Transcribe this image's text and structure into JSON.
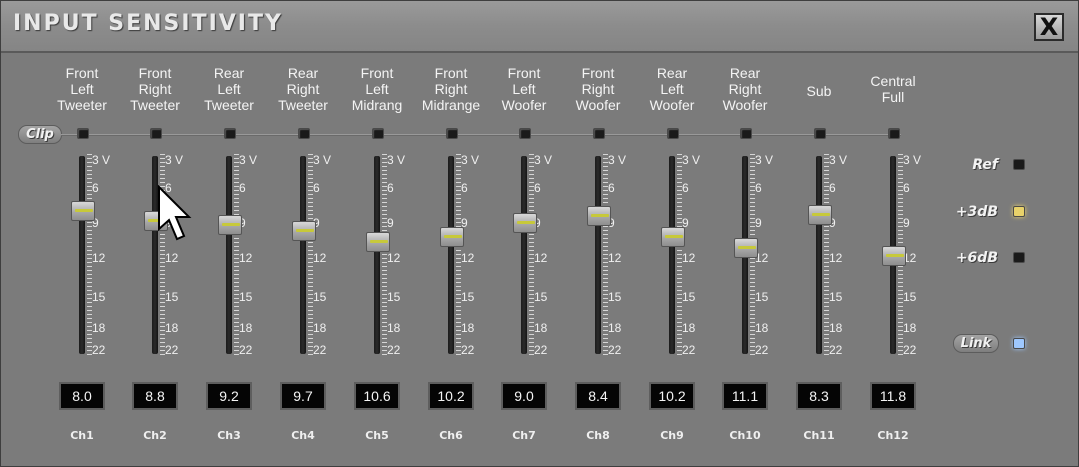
{
  "window": {
    "title": "INPUT SENSITIVITY",
    "close_label": "X"
  },
  "clip_label": "Clip",
  "scale_labels": [
    "3 V",
    "6",
    "9",
    "12",
    "15",
    "18",
    "22"
  ],
  "channels": [
    {
      "name": "Front\nLeft\nTweeter",
      "value": "8.0",
      "ch": "Ch1"
    },
    {
      "name": "Front\nRight\nTweeter",
      "value": "8.8",
      "ch": "Ch2"
    },
    {
      "name": "Rear\nLeft\nTweeter",
      "value": "9.2",
      "ch": "Ch3"
    },
    {
      "name": "Rear\nRight\nTweeter",
      "value": "9.7",
      "ch": "Ch4"
    },
    {
      "name": "Front\nLeft\nMidrang",
      "value": "10.6",
      "ch": "Ch5"
    },
    {
      "name": "Front\nRight\nMidrange",
      "value": "10.2",
      "ch": "Ch6"
    },
    {
      "name": "Front\nLeft\nWoofer",
      "value": "9.0",
      "ch": "Ch7"
    },
    {
      "name": "Front\nRight\nWoofer",
      "value": "8.4",
      "ch": "Ch8"
    },
    {
      "name": "Rear\nLeft\nWoofer",
      "value": "10.2",
      "ch": "Ch9"
    },
    {
      "name": "Rear\nRight\nWoofer",
      "value": "11.1",
      "ch": "Ch10"
    },
    {
      "name": "Sub",
      "value": "8.3",
      "ch": "Ch11"
    },
    {
      "name": "Central\nFull",
      "value": "11.8",
      "ch": "Ch12"
    }
  ],
  "side": {
    "ref_label": "Ref",
    "plus3_label": "+3dB",
    "plus6_label": "+6dB",
    "link_label": "Link",
    "plus3_active": true,
    "link_active": true
  },
  "colors": {
    "led_off": "#1a1a1a",
    "led_plus3_on": "#e8d26a",
    "led_link_on": "#9ec8ff",
    "knob_accent": "#c7c93a"
  }
}
